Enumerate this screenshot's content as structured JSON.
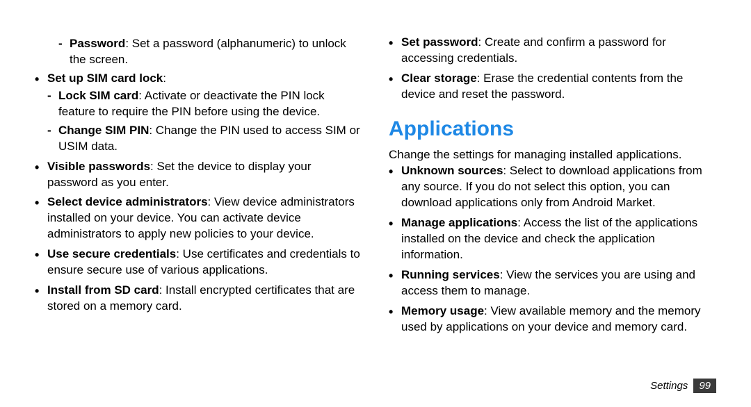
{
  "left": {
    "password_lead": "Password",
    "password_rest": ": Set a password (alphanumeric) to unlock the screen.",
    "sim_lock_lead": "Set up SIM card lock",
    "sim_lock_rest": ":",
    "lock_sim_lead": "Lock SIM card",
    "lock_sim_rest": ": Activate or deactivate the PIN lock feature to require the PIN before using the device.",
    "change_pin_lead": "Change SIM PIN",
    "change_pin_rest": ": Change the PIN used to access SIM or USIM data.",
    "visible_pw_lead": "Visible passwords",
    "visible_pw_rest": ": Set the device to display your password as you enter.",
    "dev_admin_lead": "Select device administrators",
    "dev_admin_rest": ": View device administrators installed on your device. You can activate device administrators to apply new policies to your device.",
    "secure_cred_lead": "Use secure credentials",
    "secure_cred_rest": ": Use certificates and credentials to ensure secure use of various applications.",
    "install_sd_lead": "Install from SD card",
    "install_sd_rest": ": Install encrypted certificates that are stored on a memory card."
  },
  "right": {
    "set_pw_lead": "Set password",
    "set_pw_rest": ": Create and confirm a password for accessing credentials.",
    "clear_storage_lead": "Clear storage",
    "clear_storage_rest": ": Erase the credential contents from the device and reset the password.",
    "apps_title": "Applications",
    "apps_intro": "Change the settings for managing installed applications.",
    "unknown_lead": "Unknown sources",
    "unknown_rest": ": Select to download applications from any source. If you do not select this option, you can download applications only from Android Market.",
    "manage_lead": "Manage applications",
    "manage_rest": ": Access the list of the applications installed on the device and check the application information.",
    "running_lead": "Running services",
    "running_rest": ": View the services you are using and access them to manage.",
    "memory_lead": "Memory usage",
    "memory_rest": ": View available memory and the memory used by applications on your device and memory card."
  },
  "footer": {
    "section": "Settings",
    "page": "99"
  }
}
